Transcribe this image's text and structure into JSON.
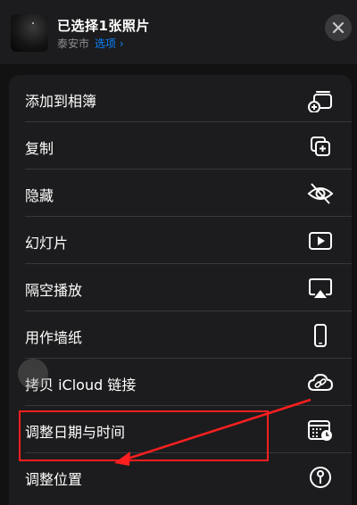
{
  "header": {
    "title": "已选择1张照片",
    "location": "泰安市",
    "options_label": "选项 ›"
  },
  "menu": {
    "items": [
      {
        "label": "添加到相簿",
        "icon": "add-to-album-icon"
      },
      {
        "label": "复制",
        "icon": "duplicate-icon"
      },
      {
        "label": "隐藏",
        "icon": "eye-slash-icon"
      },
      {
        "label": "幻灯片",
        "icon": "play-rectangle-icon"
      },
      {
        "label": "隔空播放",
        "icon": "airplay-icon"
      },
      {
        "label": "用作墙纸",
        "icon": "iphone-icon"
      },
      {
        "label": "拷贝 iCloud 链接",
        "icon": "cloud-link-icon"
      },
      {
        "label": "调整日期与时间",
        "icon": "calendar-clock-icon"
      },
      {
        "label": "调整位置",
        "icon": "location-pin-icon"
      }
    ]
  },
  "colors": {
    "accent": "#0a84ff",
    "annotation": "#ff1f1f",
    "background": "#1c1c1e"
  }
}
